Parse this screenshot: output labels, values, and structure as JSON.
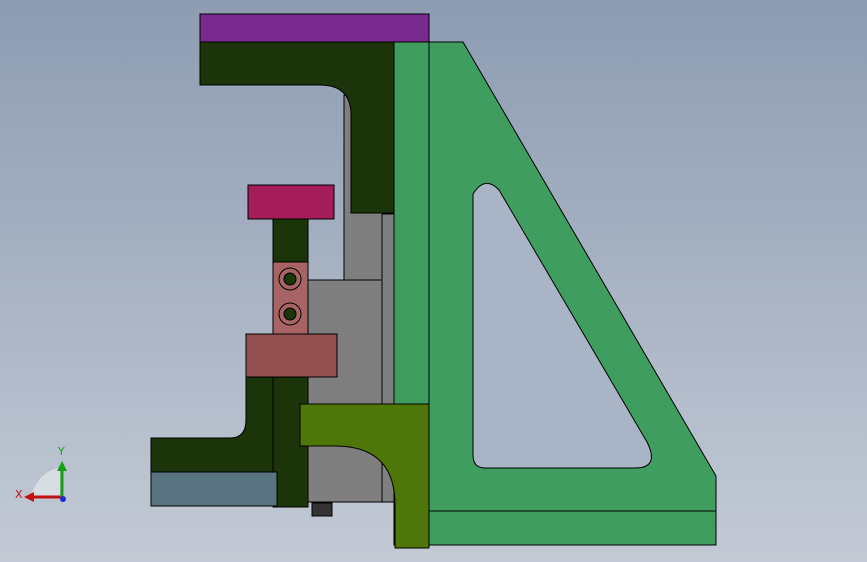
{
  "viewport": {
    "background_top": "#8d9cb2",
    "background_bottom": "#c3cad5"
  },
  "parts": [
    {
      "name": "purple-top-plate",
      "color": "#7a2a8f"
    },
    {
      "name": "green-gusset-bracket",
      "color": "#3f9d5f"
    },
    {
      "name": "dark-green-upper-arm",
      "color": "#1b3409"
    },
    {
      "name": "gray-column",
      "color": "#7f7f7f"
    },
    {
      "name": "magenta-cap",
      "color": "#a41c5a"
    },
    {
      "name": "pink-block",
      "color": "#925050"
    },
    {
      "name": "olive-curved-block",
      "color": "#4f7608"
    },
    {
      "name": "slate-base-plate",
      "color": "#5a7380"
    }
  ],
  "triad": {
    "x_label": "X",
    "y_label": "Y",
    "x_color": "#c21010",
    "y_color": "#16a016",
    "z_color": "#1a2fd0"
  }
}
